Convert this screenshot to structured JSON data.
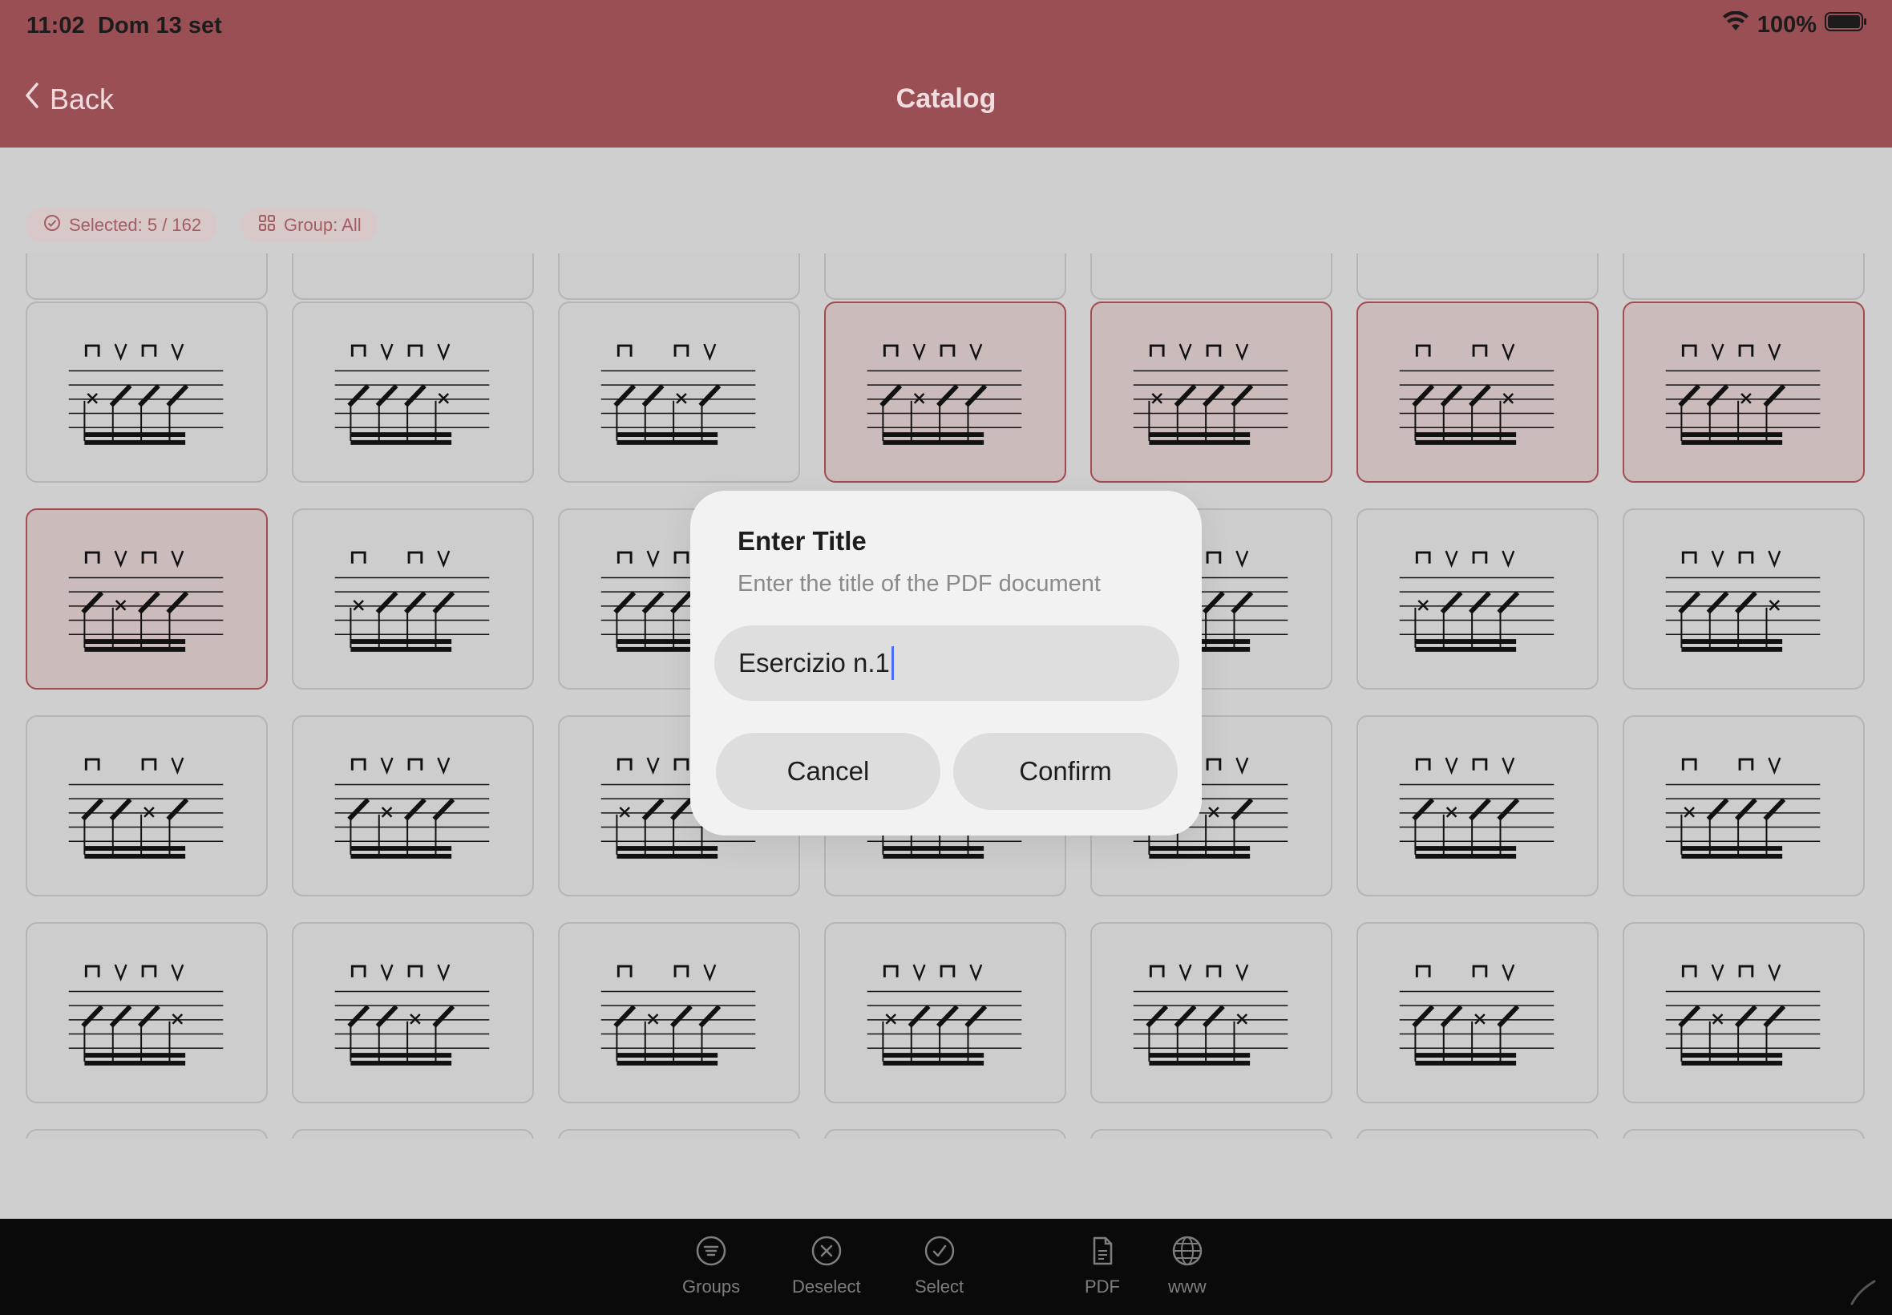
{
  "status_bar": {
    "time": "11:02",
    "date": "Dom 13 set",
    "battery": "100%"
  },
  "nav": {
    "back_label": "Back",
    "title": "Catalog"
  },
  "chips": {
    "selected": "Selected: 5 / 162",
    "group": "Group: All"
  },
  "dialog": {
    "title": "Enter Title",
    "subtitle": "Enter the title of the PDF document",
    "input_value": "Esercizio n.1",
    "cancel_label": "Cancel",
    "confirm_label": "Confirm"
  },
  "toolbar": {
    "items": [
      {
        "label": "Groups",
        "icon": "list-icon"
      },
      {
        "label": "Deselect",
        "icon": "x-circle-icon"
      },
      {
        "label": "Select",
        "icon": "check-circle-icon"
      },
      {
        "label": "PDF",
        "icon": "document-icon"
      },
      {
        "label": "www",
        "icon": "globe-icon"
      }
    ]
  },
  "colors": {
    "brand": "#9a4f55",
    "selection": "#a34b52",
    "chip_text": "#a45e63"
  },
  "grid": {
    "rows": [
      {
        "selected": [
          false,
          false,
          false,
          true,
          true,
          true,
          true
        ]
      },
      {
        "selected": [
          true,
          false,
          false,
          false,
          false,
          false,
          false
        ]
      },
      {
        "selected": [
          false,
          false,
          false,
          false,
          false,
          false,
          false
        ]
      },
      {
        "selected": [
          false,
          false,
          false,
          false,
          false,
          false,
          false
        ]
      }
    ]
  }
}
